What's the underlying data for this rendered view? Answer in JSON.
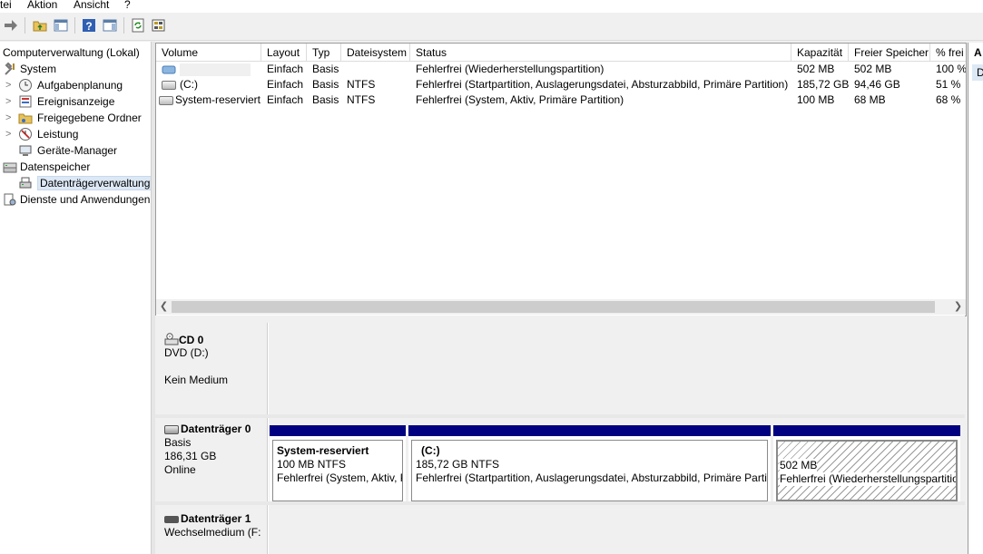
{
  "menu": [
    "tei",
    "Aktion",
    "Ansicht",
    "?"
  ],
  "toolbar_icons": [
    "forward-arrow-icon",
    "up-folder-icon",
    "show-hide-tree-icon",
    "help-icon",
    "show-hide-action-pane-icon",
    "refresh-icon",
    "export-list-icon"
  ],
  "tree": {
    "items": [
      {
        "label": "Computerverwaltung (Lokal)",
        "icon": "",
        "level": 0,
        "expander": ""
      },
      {
        "label": "System",
        "icon": "tools-icon",
        "level": 0,
        "expander": ""
      },
      {
        "label": "Aufgabenplanung",
        "icon": "clock-icon",
        "level": 1,
        "expander": ">"
      },
      {
        "label": "Ereignisanzeige",
        "icon": "event-viewer-icon",
        "level": 1,
        "expander": ">"
      },
      {
        "label": "Freigegebene Ordner",
        "icon": "shared-folder-icon",
        "level": 1,
        "expander": ">"
      },
      {
        "label": "Leistung",
        "icon": "performance-icon",
        "level": 1,
        "expander": ">"
      },
      {
        "label": "Geräte-Manager",
        "icon": "device-manager-icon",
        "level": 1,
        "expander": ""
      },
      {
        "label": "Datenspeicher",
        "icon": "storage-icon",
        "level": 0,
        "expander": ""
      },
      {
        "label": "Datenträgerverwaltung",
        "icon": "disk-management-icon",
        "level": 1,
        "expander": "",
        "selected": true
      },
      {
        "label": "Dienste und Anwendungen",
        "icon": "services-icon",
        "level": 0,
        "expander": ""
      }
    ]
  },
  "volumes": {
    "columns": [
      "Volume",
      "Layout",
      "Typ",
      "Dateisystem",
      "Status",
      "Kapazität",
      "Freier Speicher",
      "% frei"
    ],
    "rows": [
      {
        "volume": "",
        "icon": "recovery-volume-icon",
        "layout": "Einfach",
        "typ": "Basis",
        "fs": "",
        "status": "Fehlerfrei (Wiederherstellungspartition)",
        "cap": "502 MB",
        "free": "502 MB",
        "pct": "100 %"
      },
      {
        "volume": "(C:)",
        "icon": "drive-icon",
        "layout": "Einfach",
        "typ": "Basis",
        "fs": "NTFS",
        "status": "Fehlerfrei (Startpartition, Auslagerungsdatei, Absturzabbild, Primäre Partition)",
        "cap": "185,72 GB",
        "free": "94,46 GB",
        "pct": "51 %"
      },
      {
        "volume": "System-reserviert",
        "icon": "drive-icon",
        "layout": "Einfach",
        "typ": "Basis",
        "fs": "NTFS",
        "status": "Fehlerfrei (System, Aktiv, Primäre Partition)",
        "cap": "100 MB",
        "free": "68 MB",
        "pct": "68 %"
      }
    ]
  },
  "actions": {
    "title": "A",
    "item": "D"
  },
  "disks": [
    {
      "name": "CD 0",
      "lines": [
        "DVD (D:)",
        "",
        "Kein Medium"
      ],
      "partitions": []
    },
    {
      "name": "Datenträger 0",
      "lines": [
        "Basis",
        "186,31 GB",
        "Online"
      ],
      "partitions": [
        {
          "title": "System-reserviert",
          "size": "100 MB NTFS",
          "status": "Fehlerfrei (System, Aktiv, P"
        },
        {
          "title": "(C:)",
          "size": "185,72 GB NTFS",
          "status": "Fehlerfrei (Startpartition, Auslagerungsdatei, Absturzabbild, Primäre Partit"
        },
        {
          "title": "",
          "size": "502 MB",
          "status": "Fehlerfrei (Wiederherstellungspartitio"
        }
      ]
    },
    {
      "name": "Datenträger 1",
      "lines": [
        "Wechselmedium (F:"
      ],
      "partitions": []
    }
  ]
}
